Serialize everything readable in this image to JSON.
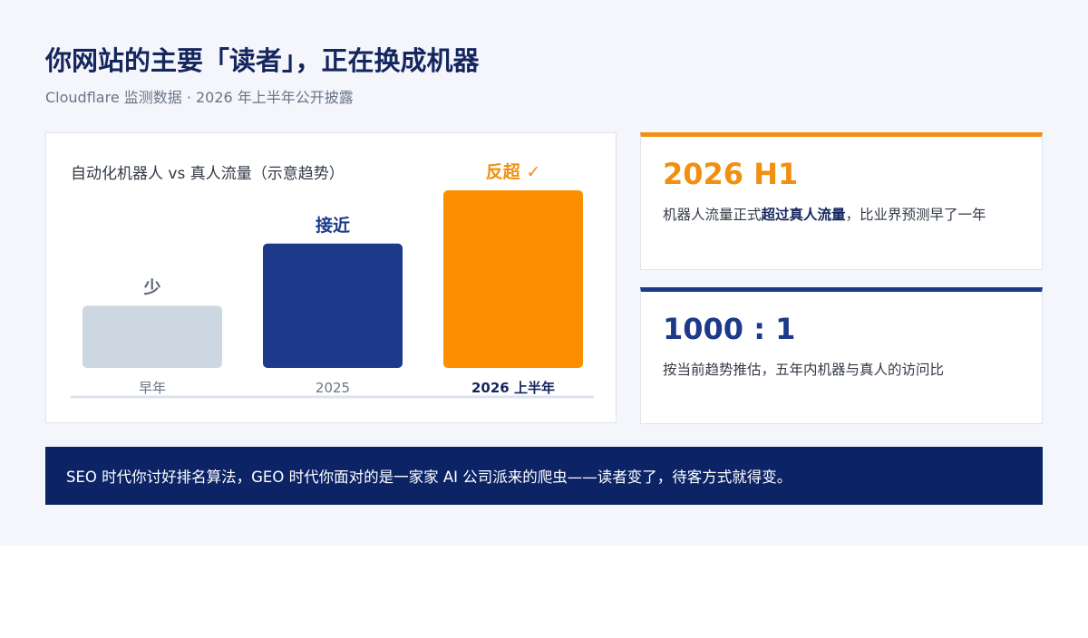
{
  "title": "你网站的主要「读者」，正在换成机器",
  "subtitle": "Cloudflare 监测数据 · 2026 年上半年公开披露",
  "chart_data": {
    "type": "bar",
    "title": "自动化机器人 vs 真人流量（示意趋势）",
    "categories": [
      "早年",
      "2025",
      "2026 上半年"
    ],
    "values": [
      0.35,
      0.7,
      1.0
    ],
    "bar_labels": [
      "少",
      "接近",
      "反超 ✓"
    ],
    "colors": [
      "#cdd7e2",
      "#1d3a8a",
      "#fb8f01"
    ],
    "label_colors": [
      "#5e6674",
      "#1d3a8a",
      "#f28f10"
    ],
    "highlight_category_index": 2,
    "ylim": [
      0,
      1
    ],
    "grid": false,
    "xlabel": "",
    "ylabel": ""
  },
  "cards": [
    {
      "value": "2026 H1",
      "desc_before": "机器人流量正式",
      "desc_bold": "超过真人流量",
      "desc_after": "，比业界预测早了一年",
      "accent": "#f28f10"
    },
    {
      "value": "1000 : 1",
      "desc": "按当前趋势推估，五年内机器与真人的访问比",
      "accent": "#1d3a8a"
    }
  ],
  "banner": {
    "text": "SEO 时代你讨好排名算法，GEO 时代你面对的是一家家 AI 公司派来的爬虫——读者变了，待客方式就得变。"
  }
}
